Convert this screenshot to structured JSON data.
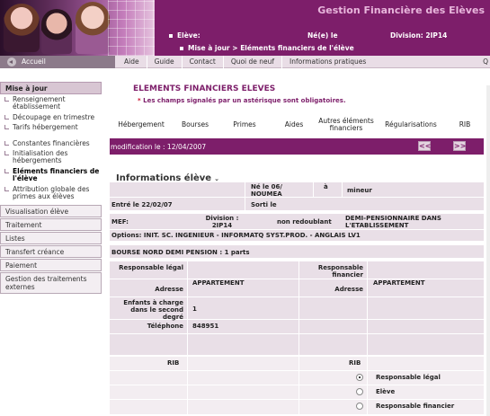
{
  "header": {
    "app_title": "Gestion Financière des Elèves",
    "eleve_label": "Elève:",
    "ne_label": "Né(e) le",
    "division_label": "Division: 2IP14",
    "breadcrumb_root": "Mise à jour",
    "breadcrumb_sep": ">",
    "breadcrumb_current": "Eléments financiers de l'élève"
  },
  "topnav": {
    "home": "Accueil",
    "links": [
      "Aide",
      "Guide",
      "Contact",
      "Quoi de neuf",
      "Informations pratiques"
    ],
    "right_cut": "Q"
  },
  "sidebar": {
    "section": "Mise à jour",
    "items": [
      "Renseignement établissement",
      "Découpage en trimestre",
      "Tarifs hébergement",
      "Constantes financières",
      "Initialisation des hébergements",
      "Eléments financiers de l'élève",
      "Attribution globale des primes aux élèves"
    ],
    "buttons": [
      "Visualisation élève",
      "Traitement",
      "Listes",
      "Transfert créance",
      "Paiement",
      "Gestion des traitements externes"
    ]
  },
  "main": {
    "title": "ELEMENTS FINANCIERS ELEVES",
    "note_star": "*",
    "note": "Les champs signalés par un astérisque sont obligatoires.",
    "tabs": [
      "Hébergement",
      "Bourses",
      "Primes",
      "Aides",
      "Autres éléments financiers",
      "Régularisations",
      "RIB"
    ],
    "modification": "modification le : 12/04/2007",
    "prev": "<<",
    "next": ">>",
    "section_title": "Informations élève",
    "info": {
      "ne_le": "Né le 06/",
      "a": "à",
      "lieu": "NOUMEA",
      "mineur": "mineur",
      "entre": "Entré le 22/02/07",
      "sorti": "Sorti le",
      "mef": "MEF:",
      "division": "Division : 2IP14",
      "redoublant": "non redoublant",
      "regime": "DEMI-PENSIONNAIRE DANS L'ETABLISSEMENT",
      "options": "Options: INIT. SC. INGENIEUR - INFORMATQ SYST.PROD. - ANGLAIS LV1",
      "bourse": "BOURSE NORD DEMI PENSION : 1 parts",
      "resp_legal": "Responsable légal",
      "resp_financier": "Responsable financier",
      "adresse_label": "Adresse",
      "adresse_legal": "APPARTEMENT",
      "adresse_financier": "APPARTEMENT",
      "enfants_label": "Enfants à charge dans le second degré",
      "enfants_value": "1",
      "telephone_label": "Téléphone",
      "telephone_value": "848951",
      "rib_left": "RIB",
      "rib_right": "RIB",
      "radio_options": [
        "Responsable légal",
        "Elève",
        "Responsable financier"
      ],
      "radio_selected": 0
    }
  }
}
